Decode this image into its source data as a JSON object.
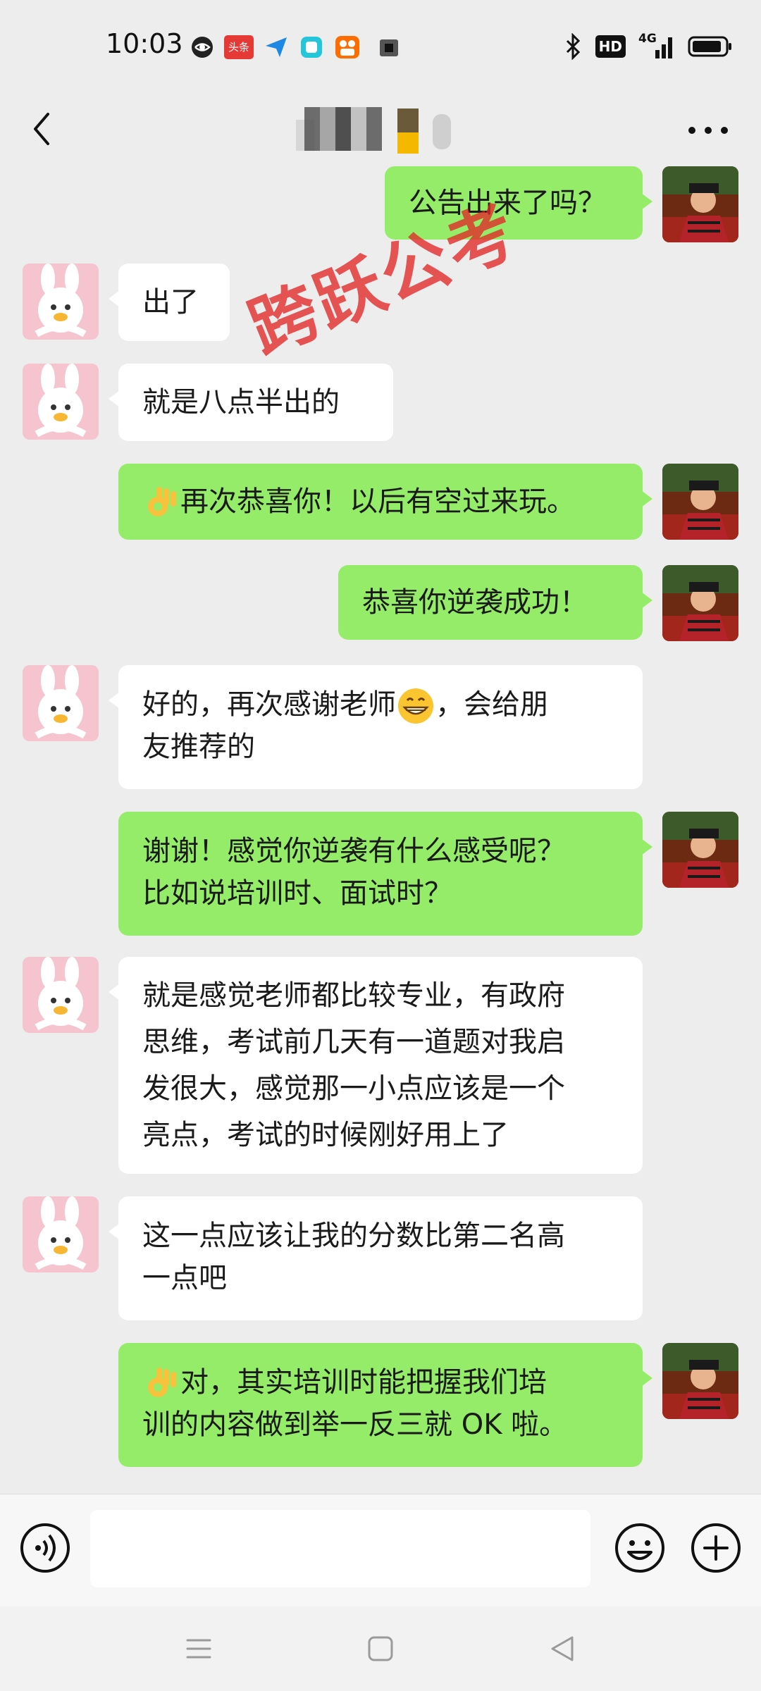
{
  "status_bar": {
    "time": "10:03",
    "app_badge": "头条",
    "network": "4G",
    "hd": "HD",
    "icons": [
      "browser-icon",
      "toutiao-icon",
      "send-icon",
      "app-icon",
      "kuaishou-icon",
      "camera-icon",
      "bluetooth-icon",
      "hd-icon",
      "signal-icon",
      "battery-icon"
    ]
  },
  "header": {
    "back_icon": "chevron-left-icon",
    "more_icon": "more-icon"
  },
  "watermark": "跨跃公考",
  "messages": [
    {
      "side": "right",
      "text": "公告出来了吗？"
    },
    {
      "side": "left",
      "text": "出了"
    },
    {
      "side": "left",
      "text": "就是八点半出的"
    },
    {
      "side": "right",
      "text": "再次恭喜你！以后有空过来玩。",
      "emoji": "ok-hand-emoji"
    },
    {
      "side": "right",
      "text": "恭喜你逆袭成功！"
    },
    {
      "side": "left",
      "lines": [
        "好的，再次感谢老师",
        "，会给朋",
        "友推荐的"
      ],
      "emoji": "grin-emoji"
    },
    {
      "side": "right",
      "lines": [
        "谢谢！感觉你逆袭有什么感受呢？",
        "比如说培训时、面试时？"
      ]
    },
    {
      "side": "left",
      "lines": [
        "就是感觉老师都比较专业，有政府",
        "思维，考试前几天有一道题对我启",
        "发很大，感觉那一小点应该是一个",
        "亮点，考试的时候刚好用上了"
      ]
    },
    {
      "side": "left",
      "lines": [
        "这一点应该让我的分数比第二名高",
        "一点吧"
      ]
    },
    {
      "side": "right",
      "lines": [
        "对，其实培训时能把握我们培",
        "训的内容做到举一反三就 OK 啦。"
      ],
      "emoji": "ok-hand-emoji"
    }
  ],
  "input_bar": {
    "placeholder": "",
    "voice_icon": "voice-icon",
    "emoji_icon": "emoji-icon",
    "plus_icon": "plus-icon"
  },
  "nav_bar": {
    "icons": [
      "menu-icon",
      "home-icon",
      "back-icon"
    ]
  },
  "colors": {
    "background": "#ededed",
    "green_bubble": "#95ec69",
    "white_bubble": "#ffffff",
    "watermark": "#e22626"
  }
}
